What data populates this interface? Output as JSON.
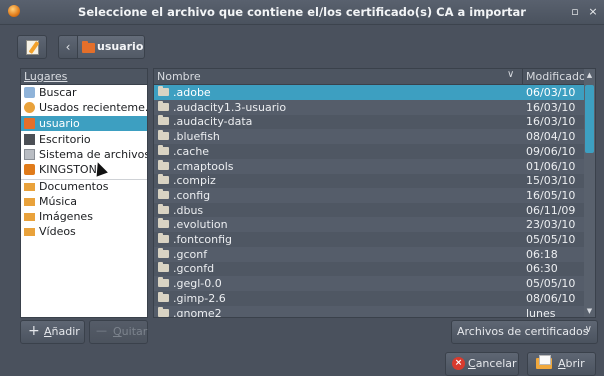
{
  "window": {
    "title": "Seleccione el archivo que contiene el/los certificado(s) CA a importar",
    "minimize_glyph": "▫",
    "close_glyph": "×"
  },
  "pathbar": {
    "back_glyph": "‹",
    "current_label": "usuario"
  },
  "places": {
    "header": "Lugares",
    "items": [
      {
        "label": "Buscar",
        "icon": "search-icon"
      },
      {
        "label": "Usados recienteme...",
        "icon": "recent-icon"
      },
      {
        "label": "usuario",
        "icon": "home-folder-icon",
        "selected": true
      },
      {
        "label": "Escritorio",
        "icon": "desktop-icon"
      },
      {
        "label": "Sistema de archivos",
        "icon": "filesystem-icon"
      },
      {
        "label": "KINGSTON",
        "icon": "usb-drive-icon"
      },
      {
        "label": "Documentos",
        "icon": "folder-icon"
      },
      {
        "label": "Música",
        "icon": "folder-icon"
      },
      {
        "label": "Imágenes",
        "icon": "folder-icon"
      },
      {
        "label": "Vídeos",
        "icon": "folder-icon"
      }
    ]
  },
  "files": {
    "col_name": "Nombre",
    "col_modified": "Modificado",
    "sort_glyph": "∨",
    "rows": [
      {
        "name": ".adobe",
        "modified": "06/03/10",
        "selected": true
      },
      {
        "name": ".audacity1.3-usuario",
        "modified": "16/03/10"
      },
      {
        "name": ".audacity-data",
        "modified": "16/03/10"
      },
      {
        "name": ".bluefish",
        "modified": "08/04/10"
      },
      {
        "name": ".cache",
        "modified": "09/06/10"
      },
      {
        "name": ".cmaptools",
        "modified": "01/06/10"
      },
      {
        "name": ".compiz",
        "modified": "15/03/10"
      },
      {
        "name": ".config",
        "modified": "16/05/10"
      },
      {
        "name": ".dbus",
        "modified": "06/11/09"
      },
      {
        "name": ".evolution",
        "modified": "23/03/10"
      },
      {
        "name": ".fontconfig",
        "modified": "05/05/10"
      },
      {
        "name": ".gconf",
        "modified": "06:18"
      },
      {
        "name": ".gconfd",
        "modified": "06:30"
      },
      {
        "name": ".gegl-0.0",
        "modified": "05/05/10"
      },
      {
        "name": ".gimp-2.6",
        "modified": "08/06/10"
      },
      {
        "name": ".gnome2",
        "modified": "lunes"
      }
    ]
  },
  "buttons": {
    "add_plus": "+",
    "add_first": "A",
    "add_rest": "ñadir",
    "remove_minus": "—",
    "remove_first": "Q",
    "remove_rest": "uitar",
    "filter": "Archivos de certificados",
    "filter_chevron": "∨",
    "cancel_first": "C",
    "cancel_rest": "ancelar",
    "open_first": "A",
    "open_rest": "brir"
  },
  "colors": {
    "selection": "#3d9fc1",
    "background": "#4a515d",
    "cancel_icon": "#d93b2e"
  }
}
